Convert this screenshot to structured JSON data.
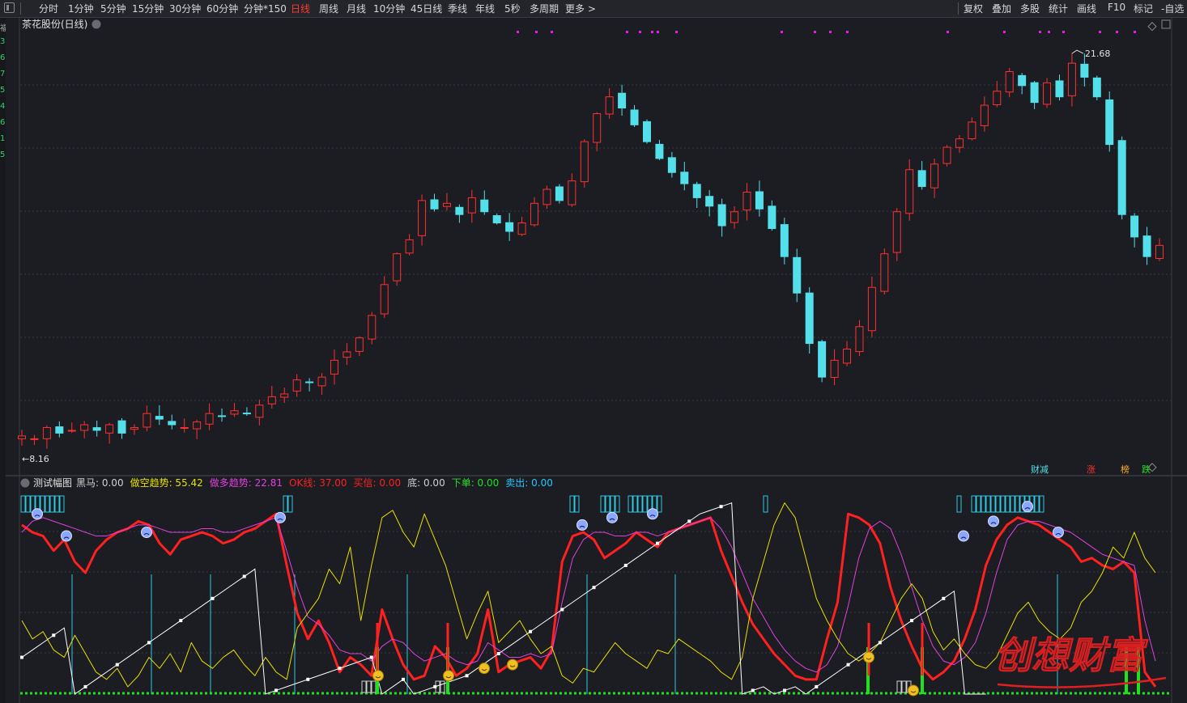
{
  "toolbar": {
    "periods": [
      {
        "label": "分时",
        "x": 48
      },
      {
        "label": "1分钟",
        "x": 84
      },
      {
        "label": "5分钟",
        "x": 124
      },
      {
        "label": "15分钟",
        "x": 163
      },
      {
        "label": "30分钟",
        "x": 209
      },
      {
        "label": "60分钟",
        "x": 255
      },
      {
        "label": "分钟*150",
        "x": 301
      },
      {
        "label": "日线",
        "x": 359,
        "active": true
      },
      {
        "label": "周线",
        "x": 394
      },
      {
        "label": "月线",
        "x": 428
      },
      {
        "label": "10分钟",
        "x": 461
      },
      {
        "label": "45日线",
        "x": 507
      },
      {
        "label": "季线",
        "x": 553
      },
      {
        "label": "年线",
        "x": 587
      },
      {
        "label": "5秒",
        "x": 623
      },
      {
        "label": "多周期",
        "x": 654
      },
      {
        "label": "更多 >",
        "x": 698
      }
    ],
    "right": [
      {
        "label": "复权",
        "x": 1190
      },
      {
        "label": "叠加",
        "x": 1225
      },
      {
        "label": "多股",
        "x": 1260
      },
      {
        "label": "统计",
        "x": 1295
      },
      {
        "label": "画线",
        "x": 1330
      },
      {
        "label": "F10",
        "x": 1368
      },
      {
        "label": "标记",
        "x": 1400
      },
      {
        "label": "-自选",
        "x": 1434
      }
    ]
  },
  "left_strip": [
    "福",
    "3",
    "6",
    "7",
    "5",
    "4",
    "6",
    "1",
    "5"
  ],
  "chart_data": [
    {
      "type": "candlestick",
      "title": "茶花股份(日线)",
      "ylim": [
        7.0,
        22.5
      ],
      "annotations": {
        "high": "21.68",
        "low": "8.16"
      },
      "bottom_tags": [
        "财减",
        "涨",
        "榜",
        "跌"
      ],
      "marker_color": "#e020e0",
      "close": [
        8.1,
        8.0,
        8.4,
        8.2,
        8.3,
        8.5,
        8.3,
        8.5,
        8.2,
        8.4,
        8.9,
        8.7,
        8.5,
        8.4,
        8.6,
        8.9,
        8.8,
        9.0,
        8.9,
        9.2,
        9.5,
        9.6,
        10.1,
        10.0,
        10.2,
        10.8,
        11.1,
        11.6,
        12.4,
        13.5,
        14.6,
        15.1,
        16.5,
        16.2,
        16.4,
        16.0,
        16.6,
        16.1,
        15.7,
        15.4,
        15.7,
        16.4,
        16.9,
        16.5,
        17.2,
        18.6,
        19.6,
        20.2,
        19.8,
        19.2,
        18.6,
        18.0,
        17.5,
        17.1,
        16.6,
        16.3,
        15.6,
        16.1,
        16.8,
        16.2,
        15.5,
        14.5,
        13.2,
        11.4,
        10.2,
        10.8,
        11.2,
        12.0,
        13.4,
        14.6,
        16.1,
        17.6,
        17.0,
        17.8,
        18.4,
        18.7,
        19.3,
        19.9,
        20.4,
        21.1,
        20.6,
        20.0,
        20.7,
        20.2,
        21.4,
        20.9,
        20.2,
        18.5,
        16.0,
        15.2,
        14.5,
        14.9
      ],
      "indicator": {
        "title": "测试幅图",
        "labels": [
          {
            "text": "黑马: 0.00",
            "color": "#d0d0d0"
          },
          {
            "text": "做空趋势: 55.42",
            "color": "#e8e000"
          },
          {
            "text": "做多趋势: 22.81",
            "color": "#e040e0"
          },
          {
            "text": "OK线: 37.00",
            "color": "#ff2020"
          },
          {
            "text": "买信: 0.00",
            "color": "#ff2020"
          },
          {
            "text": "底: 0.00",
            "color": "#d0d0d0"
          },
          {
            "text": "下单: 0.00",
            "color": "#20e020"
          },
          {
            "text": "卖出: 0.00",
            "color": "#20c8ff"
          }
        ],
        "ylim": [
          0,
          110
        ],
        "series": [
          {
            "name": "OK线",
            "color": "#ff2020",
            "values": [
              92,
              88,
              86,
              78,
              84,
              72,
              66,
              78,
              84,
              88,
              90,
              94,
              92,
              82,
              76,
              84,
              86,
              88,
              86,
              82,
              84,
              88,
              90,
              94,
              98,
              70,
              44,
              30,
              40,
              28,
              12,
              20,
              16,
              10,
              46,
              30,
              16,
              8,
              10,
              26,
              20,
              10,
              14,
              22,
              46,
              12,
              16,
              18,
              20,
              14,
              24,
              72,
              86,
              88,
              84,
              74,
              78,
              82,
              88,
              84,
              80,
              88,
              90,
              92,
              94,
              96,
              78,
              64,
              50,
              38,
              30,
              22,
              16,
              10,
              8,
              8,
              30,
              50,
              98,
              96,
              92,
              82,
              58,
              40,
              26,
              14,
              8,
              12,
              18,
              30,
              46,
              70,
              84,
              92,
              96,
              94,
              92,
              88,
              84,
              80,
              72,
              74,
              70,
              68,
              72,
              66,
              12,
              4
            ]
          },
          {
            "name": "做多趋势",
            "color": "#e040e0",
            "values": [
              88,
              94,
              96,
              94,
              92,
              90,
              88,
              86,
              86,
              88,
              90,
              92,
              92,
              90,
              88,
              88,
              88,
              90,
              90,
              88,
              88,
              90,
              92,
              94,
              96,
              78,
              58,
              42,
              38,
              32,
              24,
              22,
              22,
              18,
              26,
              30,
              28,
              22,
              18,
              20,
              22,
              18,
              16,
              18,
              28,
              24,
              20,
              20,
              22,
              20,
              22,
              50,
              74,
              84,
              88,
              88,
              86,
              86,
              88,
              88,
              86,
              88,
              90,
              92,
              94,
              96,
              90,
              80,
              66,
              52,
              42,
              32,
              24,
              18,
              14,
              12,
              16,
              26,
              48,
              74,
              90,
              94,
              90,
              76,
              58,
              40,
              26,
              18,
              16,
              20,
              28,
              44,
              66,
              84,
              92,
              94,
              94,
              92,
              90,
              88,
              84,
              80,
              76,
              74,
              72,
              70,
              40,
              18
            ]
          },
          {
            "name": "做空趋势",
            "color": "#e8e000",
            "values": [
              40,
              30,
              34,
              24,
              20,
              32,
              22,
              12,
              8,
              14,
              4,
              10,
              20,
              14,
              22,
              12,
              28,
              18,
              14,
              20,
              24,
              16,
              10,
              20,
              12,
              8,
              36,
              44,
              52,
              68,
              60,
              80,
              40,
              70,
              96,
              100,
              88,
              80,
              98,
              84,
              70,
              50,
              30,
              44,
              56,
              28,
              34,
              40,
              30,
              22,
              26,
              10,
              6,
              14,
              12,
              20,
              28,
              22,
              18,
              14,
              24,
              22,
              30,
              26,
              22,
              18,
              12,
              8,
              20,
              52,
              72,
              92,
              104,
              96,
              74,
              52,
              40,
              30,
              22,
              18,
              22,
              28,
              40,
              52,
              60,
              52,
              34,
              24,
              30,
              22,
              16,
              14,
              20,
              32,
              44,
              50,
              40,
              34,
              30,
              36,
              50,
              56,
              66,
              80,
              74,
              88,
              74,
              66
            ]
          },
          {
            "name": "黑马",
            "color": "#ffffff",
            "values": [
              20,
              24,
              28,
              32,
              36,
              0,
              4,
              8,
              12,
              16,
              20,
              24,
              28,
              32,
              36,
              40,
              44,
              48,
              52,
              56,
              60,
              64,
              68,
              0,
              2,
              4,
              6,
              8,
              10,
              12,
              14,
              16,
              18,
              20,
              0,
              4,
              8,
              0,
              2,
              4,
              6,
              8,
              10,
              14,
              18,
              22,
              26,
              30,
              34,
              38,
              42,
              46,
              50,
              54,
              58,
              62,
              66,
              70,
              74,
              78,
              82,
              86,
              90,
              94,
              98,
              100,
              102,
              104,
              0,
              2,
              4,
              0,
              2,
              4,
              0,
              4,
              8,
              12,
              16,
              20,
              24,
              28,
              32,
              36,
              40,
              44,
              48,
              52,
              56,
              0,
              0,
              0
            ]
          }
        ],
        "cyan_line_x": [
          89,
          187,
          260,
          364,
          503,
          725,
          834,
          1306
        ],
        "green_bar_x": [
          466,
          553,
          1072,
          1139,
          1391,
          1406
        ],
        "smiles": [
          [
            467,
            10
          ],
          [
            554,
            10
          ],
          [
            598,
            14
          ],
          [
            633,
            16
          ],
          [
            1073,
            20
          ],
          [
            1128,
            2
          ]
        ],
        "frowns": [
          [
            46,
            98
          ],
          [
            82,
            86
          ],
          [
            181,
            88
          ],
          [
            346,
            96
          ],
          [
            719,
            92
          ],
          [
            756,
            96
          ],
          [
            806,
            98
          ],
          [
            1190,
            86
          ],
          [
            1227,
            94
          ],
          [
            1269,
            102
          ],
          [
            1307,
            88
          ]
        ]
      }
    }
  ],
  "watermark": "创想财富"
}
